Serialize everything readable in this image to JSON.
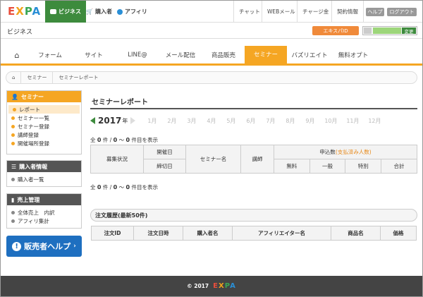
{
  "header": {
    "logo": [
      "E",
      "X",
      "P",
      "A"
    ],
    "tabs": [
      {
        "label": "ビジネス",
        "icon": "briefcase-icon"
      },
      {
        "label": "購入者",
        "icon": "cart-icon"
      },
      {
        "label": "アフィリ",
        "icon": "affiliate-icon"
      }
    ],
    "links": [
      "チャット",
      "WEBメール",
      "チャージ金",
      "契約情報"
    ],
    "help_label": "ヘルプ",
    "logout_label": "ログアウト"
  },
  "bizbar": {
    "label": "ビジネス",
    "id_button": "エキスパID",
    "change_label": "変更"
  },
  "mainnav": {
    "home_icon": "home-icon",
    "tabs": [
      "フォーム",
      "サイト",
      "LINE@",
      "メール配信",
      "商品販売",
      "セミナー",
      "バズリエイト",
      "無料オプト"
    ],
    "active": "セミナー"
  },
  "breadcrumb": {
    "items": [
      "セミナー",
      "セミナーレポート"
    ]
  },
  "sidebar": {
    "seminar": {
      "title": "セミナー",
      "items": [
        "レポート",
        "セミナー一覧",
        "セミナー登録",
        "講師登録",
        "開催場所登録"
      ]
    },
    "buyer": {
      "title": "購入者情報",
      "items": [
        "購入者一覧"
      ]
    },
    "sales": {
      "title": "売上管理",
      "items": [
        "全体売上　内訳",
        "アフィリ集計"
      ]
    },
    "help_button": "販売者ヘルプ",
    "help_symbol": "!"
  },
  "content": {
    "title": "セミナーレポート",
    "year": "2017",
    "year_suffix": "年",
    "months": [
      "1月",
      "2月",
      "3月",
      "4月",
      "5月",
      "6月",
      "7月",
      "8月",
      "9月",
      "10月",
      "11月",
      "12月"
    ],
    "count": {
      "prefix": "全",
      "total": "0",
      "unit1": "件 /",
      "from": "0",
      "tilde": "〜",
      "to": "0",
      "suffix": "件目を表示"
    },
    "table": {
      "status": "募集状況",
      "open_date": "開催日",
      "close_date": "締切日",
      "name": "セミナー名",
      "lecturer": "講師",
      "apps": "申込数",
      "apps_paid": "(支払済み人数)",
      "free": "無料",
      "general": "一般",
      "special": "特別",
      "total": "合計"
    },
    "history_title": "注文履歴(最新50件)",
    "history_cols": [
      "注文ID",
      "注文日時",
      "購入者名",
      "アフィリエイター名",
      "商品名",
      "価格"
    ]
  },
  "footer": {
    "copyright": "© 2017"
  },
  "colors": {
    "accent": "#f5a623",
    "green": "#3d8b3d",
    "help": "#1e6fc0"
  }
}
